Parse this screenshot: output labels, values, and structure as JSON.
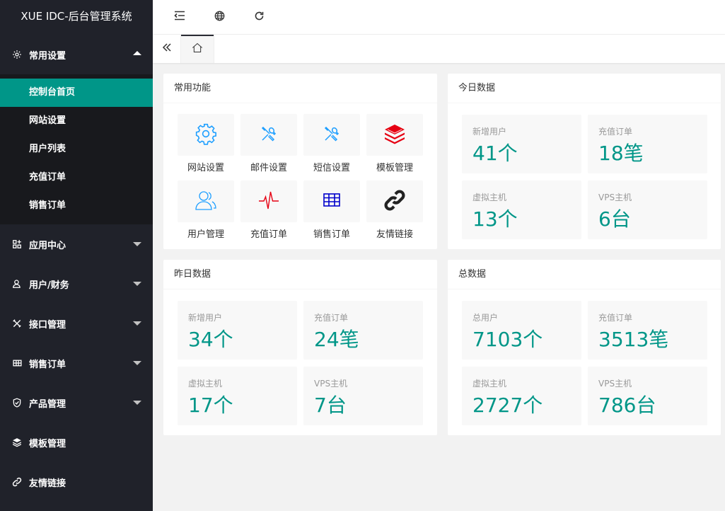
{
  "app": {
    "title": "XUE IDC-后台管理系统"
  },
  "sidebar": {
    "groups": [
      {
        "label": "常用设置",
        "icon": "gear-icon",
        "expanded": true,
        "items": [
          {
            "label": "控制台首页",
            "active": true
          },
          {
            "label": "网站设置"
          },
          {
            "label": "用户列表"
          },
          {
            "label": "充值订单"
          },
          {
            "label": "销售订单"
          }
        ]
      },
      {
        "label": "应用中心",
        "icon": "apps-icon"
      },
      {
        "label": "用户/财务",
        "icon": "user-icon"
      },
      {
        "label": "接口管理",
        "icon": "tools-icon"
      },
      {
        "label": "销售订单",
        "icon": "table-icon"
      },
      {
        "label": "产品管理",
        "icon": "shield-icon"
      },
      {
        "label": "模板管理",
        "icon": "layers-icon"
      },
      {
        "label": "友情链接",
        "icon": "link-icon"
      }
    ]
  },
  "topbar": {
    "icons": [
      "menu-collapse-icon",
      "globe-icon",
      "refresh-icon"
    ]
  },
  "tabs": {
    "prev_icon": "double-chevron-left-icon",
    "home_icon": "home-icon"
  },
  "cards": {
    "functions": {
      "title": "常用功能",
      "items": [
        {
          "label": "网站设置",
          "icon": "gear-icon"
        },
        {
          "label": "邮件设置",
          "icon": "tools-icon"
        },
        {
          "label": "短信设置",
          "icon": "tools-icon"
        },
        {
          "label": "模板管理",
          "icon": "layers-icon"
        },
        {
          "label": "用户管理",
          "icon": "users-icon"
        },
        {
          "label": "充值订单",
          "icon": "pulse-icon"
        },
        {
          "label": "销售订单",
          "icon": "table-icon"
        },
        {
          "label": "友情链接",
          "icon": "link-icon"
        }
      ]
    },
    "today": {
      "title": "今日数据",
      "stats": [
        {
          "label": "新增用户",
          "value": "41个"
        },
        {
          "label": "充值订单",
          "value": "18笔"
        },
        {
          "label": "虚拟主机",
          "value": "13个"
        },
        {
          "label": "VPS主机",
          "value": "6台"
        }
      ]
    },
    "yesterday": {
      "title": "昨日数据",
      "stats": [
        {
          "label": "新增用户",
          "value": "34个"
        },
        {
          "label": "充值订单",
          "value": "24笔"
        },
        {
          "label": "虚拟主机",
          "value": "17个"
        },
        {
          "label": "VPS主机",
          "value": "7台"
        }
      ]
    },
    "total": {
      "title": "总数据",
      "stats": [
        {
          "label": "总用户",
          "value": "7103个"
        },
        {
          "label": "充值订单",
          "value": "3513笔"
        },
        {
          "label": "虚拟主机",
          "value": "2727个"
        },
        {
          "label": "VPS主机",
          "value": "786台"
        }
      ]
    }
  },
  "colors": {
    "accent": "#009688",
    "sidebar": "#20222a",
    "submenu": "#18191d"
  }
}
